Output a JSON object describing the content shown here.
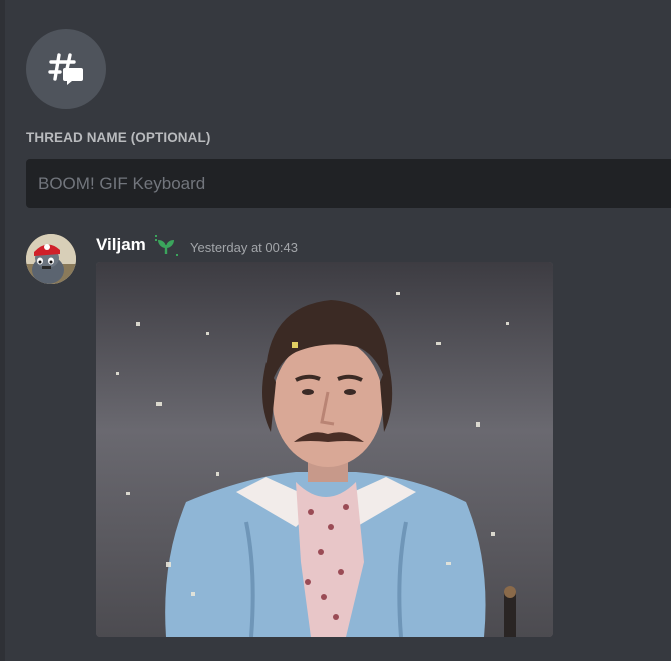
{
  "thread": {
    "icon": "thread-icon",
    "name_label": "THREAD NAME (OPTIONAL)",
    "name_value": "",
    "name_placeholder": "BOOM! GIF Keyboard"
  },
  "message": {
    "author": "Viljam",
    "avatar_icon": "user-avatar",
    "badge_icon": "sprout-badge-icon",
    "timestamp": "Yesterday at 00:43",
    "attachment": "gif-attachment"
  },
  "colors": {
    "background": "#36393f",
    "sidebar_edge": "#2f3136",
    "input_background": "#202225",
    "icon_circle": "#4f545c",
    "label": "#b9bbbe",
    "timestamp": "#a3a6aa",
    "badge_green": "#3ba55c"
  }
}
